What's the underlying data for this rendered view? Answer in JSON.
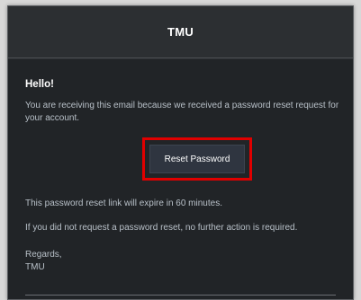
{
  "header": {
    "brand": "TMU"
  },
  "email": {
    "greeting": "Hello!",
    "intro": "You are receiving this email because we received a password reset request for your account.",
    "action_label": "Reset Password",
    "expiry_note": "This password reset link will expire in 60 minutes.",
    "no_action_note": "If you did not request a password reset, no further action is required.",
    "closing": "Regards,",
    "signature": "TMU"
  },
  "colors": {
    "background": "#212427",
    "header": "#2c2f32",
    "button": "#2f3540",
    "highlight": "#e00000",
    "text": "#b8c0c8"
  }
}
